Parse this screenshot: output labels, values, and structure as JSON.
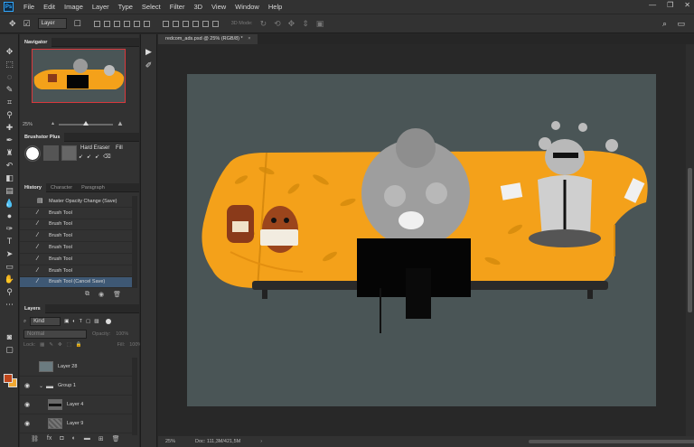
{
  "app": {
    "logo": "Ps"
  },
  "menu": [
    "File",
    "Edit",
    "Image",
    "Layer",
    "Type",
    "Select",
    "Filter",
    "3D",
    "View",
    "Window",
    "Help"
  ],
  "window_controls": [
    "minimize-icon",
    "maximize-icon",
    "close-icon"
  ],
  "options_bar": {
    "auto_select_value": "Layer",
    "mode_3d_label": "3D Mode:"
  },
  "navigator": {
    "tab_label": "Navigator",
    "zoom": "25%"
  },
  "brushes": {
    "tab_label": "Brushstor Plus",
    "hard_eraser_label": "Hard Eraser",
    "fill_label": "Fill"
  },
  "history": {
    "tabs": [
      "History",
      "Character",
      "Paragraph"
    ],
    "items": [
      "Master Opacity Change (Save)",
      "Brush Tool",
      "Brush Tool",
      "Brush Tool",
      "Brush Tool",
      "Brush Tool",
      "Brush Tool",
      "Brush Tool (Cancel Save)"
    ],
    "selected_index": 7
  },
  "layers": {
    "tab_label": "Layers",
    "filter_value": "Kind",
    "blend_mode": "Normal",
    "opacity_label": "Opacity:",
    "opacity_value": "100%",
    "lock_label": "Lock:",
    "fill_label": "Fill:",
    "fill_value": "100%",
    "items": [
      {
        "name": "Layer 28",
        "visible": false
      },
      {
        "name": "Group 1",
        "visible": true
      },
      {
        "name": "Layer 4",
        "visible": true
      },
      {
        "name": "Layer 9",
        "visible": true
      }
    ]
  },
  "document": {
    "tab_title": "redcom_ads.psd @ 25% (RGB/8) *",
    "status_zoom": "25%",
    "status_doc": "Doc: 111,3M/421,5M"
  },
  "colors": {
    "foreground": "#c0461a",
    "background": "#f0a832",
    "canvas_bg": "#4a5556",
    "sofa": "#f4a11a",
    "selected_row": "#3e5874"
  }
}
